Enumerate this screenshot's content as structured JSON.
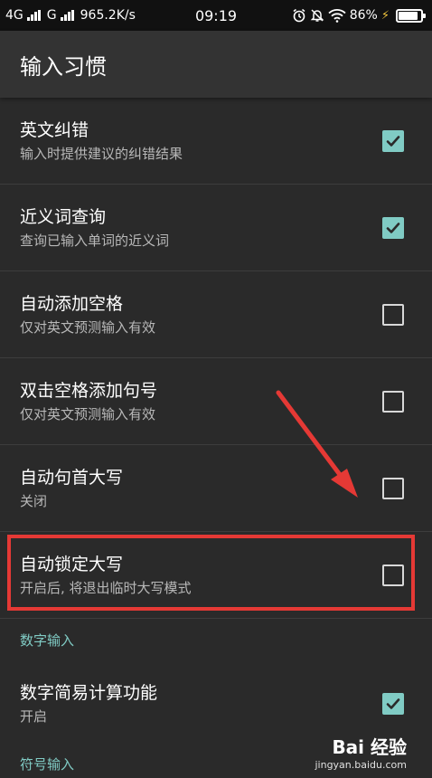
{
  "status_bar": {
    "network1": "4G",
    "network2": "G",
    "speed": "965.2K/s",
    "time": "09:19",
    "battery": "86%",
    "battery_level": 0.86,
    "icons": [
      "alarm-icon",
      "mute-bell-icon",
      "wifi-icon",
      "charging-bolt-icon"
    ]
  },
  "app_bar": {
    "title": "输入习惯"
  },
  "colors": {
    "accent": "#80cbc4",
    "background": "#2a2a2a",
    "appbar": "#333333",
    "highlight": "#e53935"
  },
  "settings": [
    {
      "title": "英文纠错",
      "summary": "输入时提供建议的纠错结果",
      "checked": true
    },
    {
      "title": "近义词查询",
      "summary": "查询已输入单词的近义词",
      "checked": true
    },
    {
      "title": "自动添加空格",
      "summary": "仅对英文预测输入有效",
      "checked": false
    },
    {
      "title": "双击空格添加句号",
      "summary": "仅对英文预测输入有效",
      "checked": false
    },
    {
      "title": "自动句首大写",
      "summary": "关闭",
      "checked": false
    },
    {
      "title": "自动锁定大写",
      "summary": "开启后, 将退出临时大写模式",
      "checked": false
    }
  ],
  "sections": [
    {
      "header": "数字输入",
      "items": [
        {
          "title": "数字简易计算功能",
          "summary": "开启",
          "checked": true
        }
      ]
    },
    {
      "header": "符号输入"
    }
  ],
  "watermark": {
    "logo": "Bai 经验",
    "url": "jingyan.baidu.com"
  }
}
